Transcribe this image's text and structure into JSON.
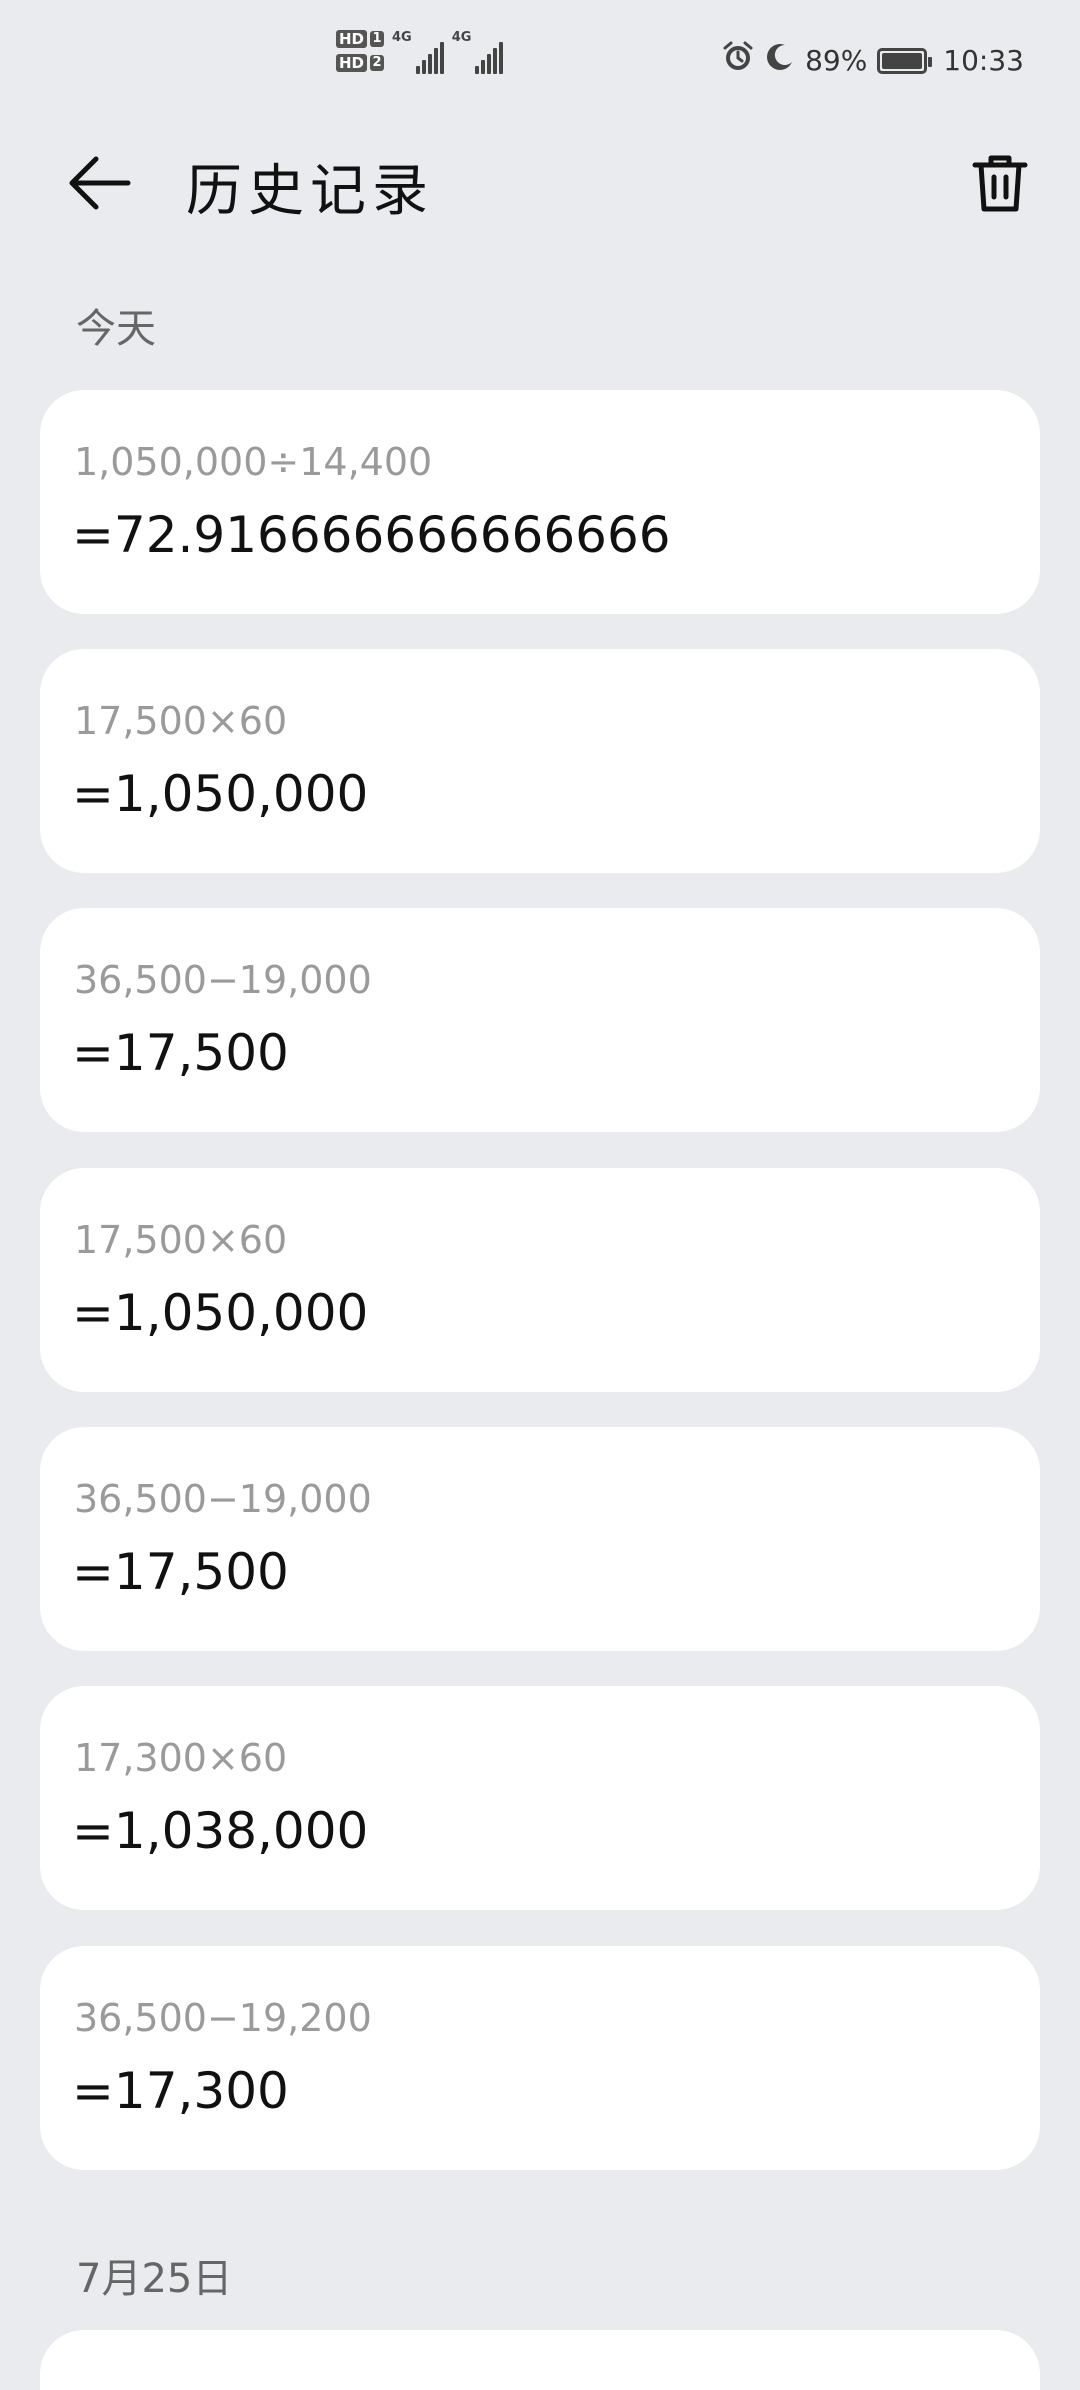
{
  "status_bar": {
    "sim1": "HD",
    "sim1_num": "1",
    "sim2": "HD",
    "sim2_num": "2",
    "network1": "4G",
    "network2": "4G",
    "battery_percent": "89%",
    "time": "10:33",
    "icons": [
      "alarm-icon",
      "moon-icon",
      "battery-icon"
    ]
  },
  "header": {
    "title": "历史记录",
    "back_icon": "arrow-left-icon",
    "delete_icon": "trash-icon"
  },
  "sections": [
    {
      "label": "今天",
      "entries": [
        {
          "expression": "1,050,000÷14,400",
          "result": "=72.916666666666666"
        },
        {
          "expression": "17,500×60",
          "result": "=1,050,000"
        },
        {
          "expression": "36,500−19,000",
          "result": "=17,500"
        },
        {
          "expression": "17,500×60",
          "result": "=1,050,000"
        },
        {
          "expression": "36,500−19,000",
          "result": "=17,500"
        },
        {
          "expression": "17,300×60",
          "result": "=1,038,000"
        },
        {
          "expression": "36,500−19,200",
          "result": "=17,300"
        }
      ]
    },
    {
      "label": "7月25日",
      "entries": []
    }
  ],
  "colors": {
    "background": "#e9ebef",
    "card": "#ffffff",
    "expression_text": "#9a9a9a",
    "result_text": "#111111"
  }
}
